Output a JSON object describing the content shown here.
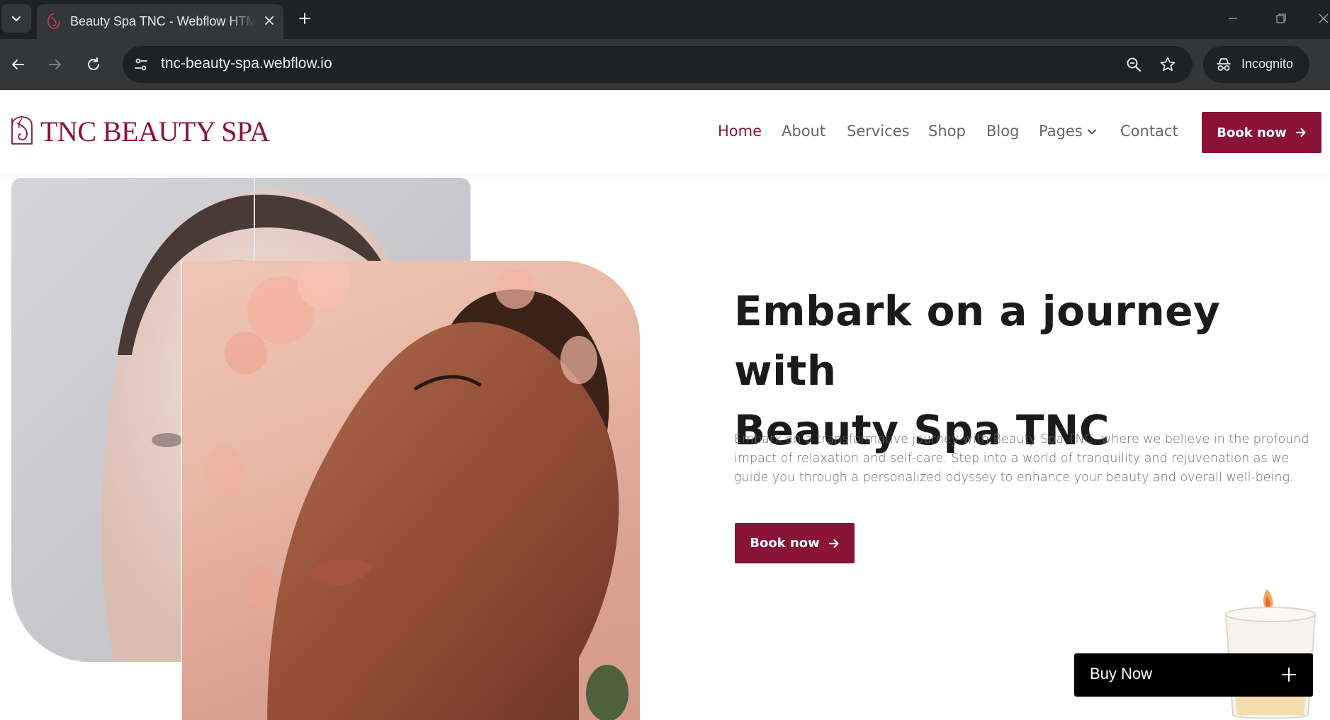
{
  "browser": {
    "tab": {
      "title": "Beauty Spa TNC - Webflow HTML",
      "favicon": "spa-logo-icon"
    },
    "url": "tnc-beauty-spa.webflow.io",
    "profile_label": "Incognito",
    "icons": {
      "tab_search": "chevron-down-icon",
      "tab_close": "close-icon",
      "new_tab": "plus-icon",
      "back": "arrow-left-icon",
      "forward": "arrow-right-icon",
      "reload": "reload-icon",
      "site_info": "tune-icon",
      "zoom": "zoom-icon",
      "bookmark": "star-icon",
      "incognito": "incognito-icon",
      "minimize": "minimize-icon",
      "restore": "restore-icon",
      "close_window": "close-window-icon"
    }
  },
  "site": {
    "brand": {
      "name": "TNC BEAUTY SPA",
      "logo": "spa-logo-icon"
    },
    "nav": {
      "items": [
        {
          "label": "Home",
          "active": true
        },
        {
          "label": "About",
          "active": false
        },
        {
          "label": "Services",
          "active": false
        },
        {
          "label": "Shop",
          "active": false
        },
        {
          "label": "Blog",
          "active": false
        },
        {
          "label": "Pages",
          "active": false,
          "has_dropdown": true
        },
        {
          "label": "Contact",
          "active": false
        }
      ],
      "cta_label": "Book now"
    },
    "hero": {
      "heading_line1": "Embark on a journey with",
      "heading_line2": "Beauty Spa TNC",
      "text": "Embark on a transformative journey with Beauty Spa TNC, where we believe in the profound impact of relaxation and self-care. Step into a world of tranquility and rejuvenation as we guide you through a personalized odyssey to enhance your beauty and overall well-being.",
      "cta_label": "Book now"
    },
    "buy_now": {
      "label": "Buy Now"
    },
    "colors": {
      "accent": "#8a1238",
      "heading": "#1a1a1a",
      "body": "#6a6a6a",
      "nav": "#666666"
    }
  }
}
